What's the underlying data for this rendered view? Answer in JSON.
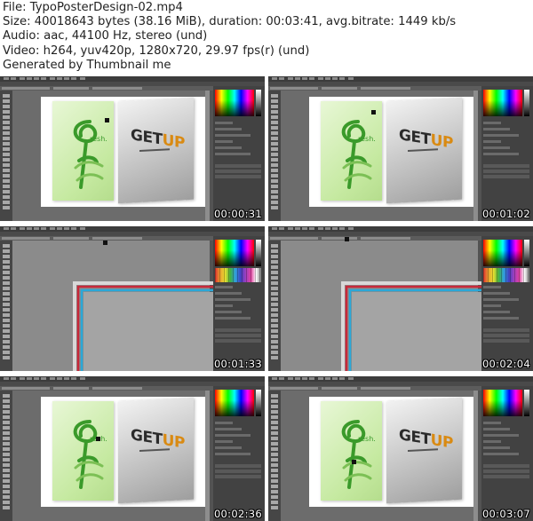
{
  "header": {
    "file": "File: TypoPosterDesign-02.mp4",
    "size": "Size: 40018643 bytes (38.16 MiB), duration: 00:03:41, avg.bitrate: 1449 kb/s",
    "audio": "Audio: aac, 44100 Hz, stereo (und)",
    "video": "Video: h264, yuv420p, 1280x720, 29.97 fps(r) (und)",
    "generator": "Generated by Thumbnail me"
  },
  "thumbnails": [
    {
      "timestamp": "00:00:31",
      "scene": "poster"
    },
    {
      "timestamp": "00:01:02",
      "scene": "poster"
    },
    {
      "timestamp": "00:01:33",
      "scene": "zoomed-edge"
    },
    {
      "timestamp": "00:02:04",
      "scene": "zoomed-edge"
    },
    {
      "timestamp": "00:02:36",
      "scene": "poster"
    },
    {
      "timestamp": "00:03:07",
      "scene": "poster"
    }
  ],
  "poster": {
    "left_text": "resh.",
    "right_text_main": "GET",
    "right_text_accent": "UP",
    "left_accent_color": "#3a9a2a",
    "right_accent_color": "#d98a12"
  },
  "colors": {
    "app_background": "#535353",
    "guide_red": "#c8283a",
    "guide_cyan": "#2aa8d8",
    "guide_grey": "#d8d8d8"
  }
}
